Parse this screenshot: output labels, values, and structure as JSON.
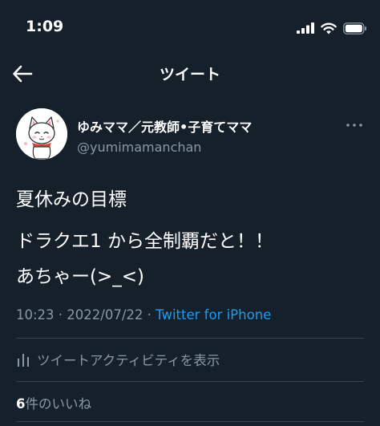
{
  "status_bar": {
    "time": "1:09"
  },
  "nav": {
    "title": "ツイート"
  },
  "tweet": {
    "author_name": "ゆみママ／元教師•子育てママ",
    "author_handle": "@yumimamanchan",
    "text_lines": [
      "夏休みの目標",
      "ドラクエ1 から全制覇だと！！",
      "あちゃー(>_<)"
    ],
    "timestamp": "10:23 · 2022/07/22 · ",
    "source": "Twitter for iPhone",
    "activity_label": "ツイートアクティビティを表示",
    "likes_count": "6",
    "likes_label": "件のいいね"
  },
  "colors": {
    "background": "#15202b",
    "text_primary": "#ffffff",
    "text_secondary": "#8899a6",
    "link": "#1d9bf0",
    "divider": "#38444d"
  },
  "icons": [
    "signal-icon",
    "wifi-icon",
    "battery-icon",
    "back-arrow-icon",
    "more-icon",
    "activity-bars-icon"
  ]
}
